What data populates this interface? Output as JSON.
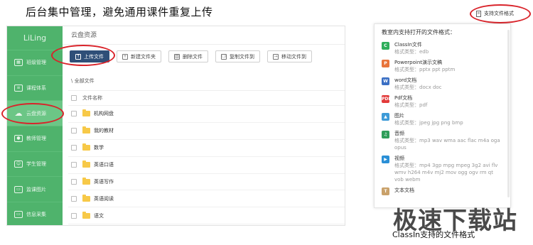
{
  "headline": "后台集中管理，避免通用课件重复上传",
  "app": {
    "brand": "LiLing",
    "nav": [
      {
        "label": "班级管理",
        "icon": "grid-icon",
        "active": false
      },
      {
        "label": "课程体系",
        "icon": "list-icon",
        "active": false
      },
      {
        "label": "云盘资源",
        "icon": "cloud-icon",
        "active": true
      },
      {
        "label": "教师管理",
        "icon": "person-icon",
        "active": false
      },
      {
        "label": "学生管理",
        "icon": "student-icon",
        "active": false
      },
      {
        "label": "监课图片",
        "icon": "monitor-icon",
        "active": false
      },
      {
        "label": "信息采集",
        "icon": "screen-icon",
        "active": false
      }
    ],
    "content_title": "云盘资源",
    "toolbar": {
      "upload": "上传文件",
      "new_folder": "新建文件夹",
      "delete": "删除文件",
      "copy": "复制文件到",
      "move": "移动文件到"
    },
    "breadcrumb": "\\ 全部文件",
    "list_header": "文件名称",
    "folders": [
      "机构网盘",
      "我的教材",
      "数学",
      "英语口语",
      "英语写作",
      "英语阅读",
      "语文"
    ]
  },
  "support_button": "支持文件格式",
  "formats_panel": {
    "title": "教室内支持打开的文件格式：",
    "items": [
      {
        "name": "ClassIn文件",
        "types": "格式类型：edb",
        "color": "#2fae5b",
        "glyph": "C"
      },
      {
        "name": "Powerpoint演示文稿",
        "types": "格式类型：pptx ppt pptm",
        "color": "#e8743b",
        "glyph": "P"
      },
      {
        "name": "word文档",
        "types": "格式类型：docx doc",
        "color": "#3b6fc4",
        "glyph": "W"
      },
      {
        "name": "Pdf文档",
        "types": "格式类型：pdf",
        "color": "#e23b3b",
        "glyph": "PDF"
      },
      {
        "name": "图片",
        "types": "格式类型：jpeg jpg png bmp",
        "color": "#3e9bd8",
        "glyph": "▲"
      },
      {
        "name": "音频",
        "types": "格式类型：mp3 wav wma aac flac m4a oga opus",
        "color": "#2f9e5a",
        "glyph": "♫"
      },
      {
        "name": "视频",
        "types": "格式类型：mp4 3gp mpg mpeg 3g2 avi flv wmv h264 m4v mj2 mov ogg ogv rm qt vob webm",
        "color": "#2a8fd6",
        "glyph": "▶"
      },
      {
        "name": "文本文档",
        "types": "",
        "color": "#c9a16a",
        "glyph": "T"
      }
    ]
  },
  "caption": "ClassIn支持的文件格式",
  "watermark": "极速下载站"
}
